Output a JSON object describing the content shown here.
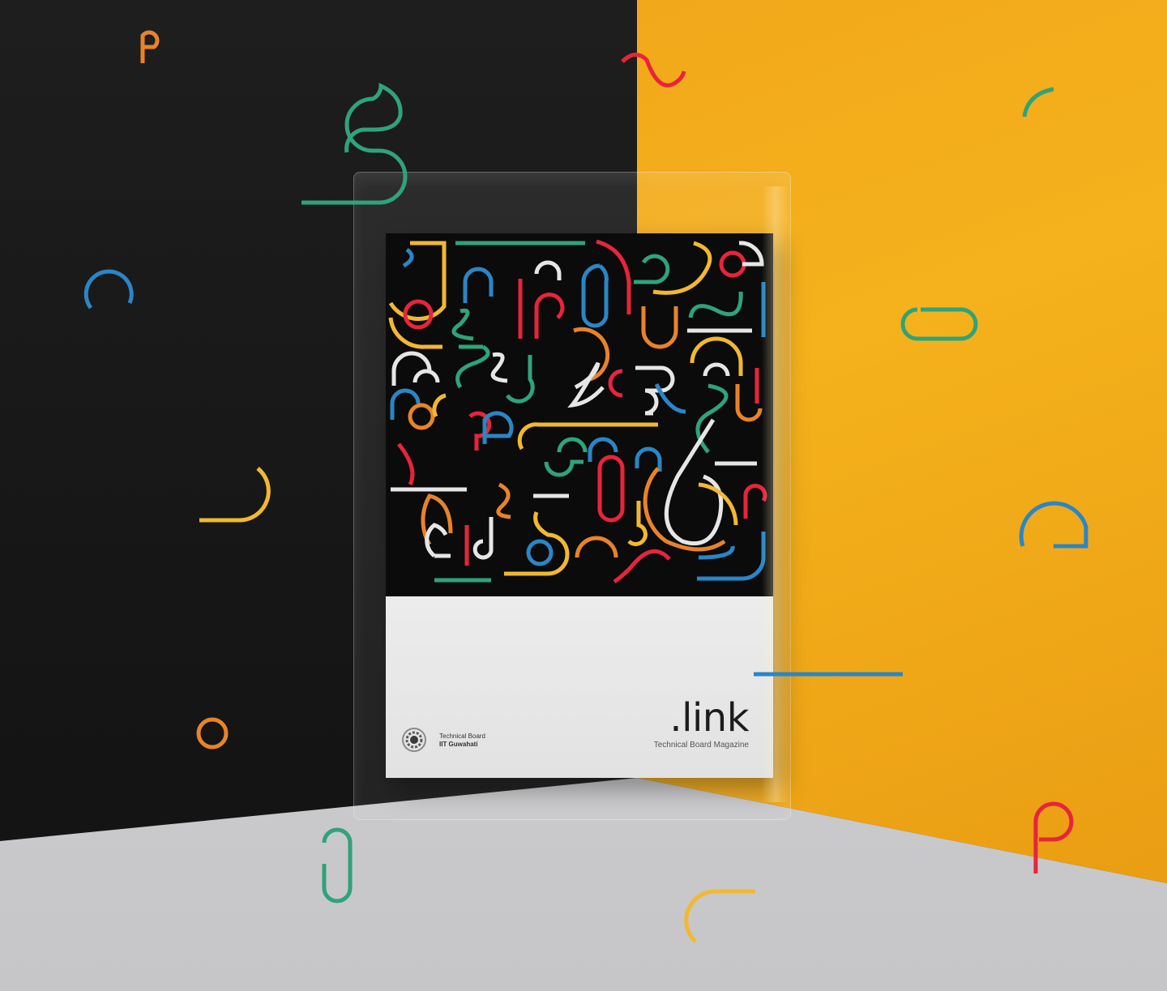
{
  "magazine": {
    "title": ".link",
    "subtitle": "Technical Board Magazine"
  },
  "publisher": {
    "line1": "Technical Board",
    "line2": "IIT Guwahati",
    "logo_icon": "gear-ring-icon"
  },
  "colors": {
    "left_wall": "#1e1e1e",
    "right_wall": "#f5b21c",
    "floor": "#d0d0d2",
    "cover_background": "#0b0b0b",
    "cover_bottom": "#e6e6e6",
    "accent_green": "#2fa37a",
    "accent_blue": "#2a86c6",
    "accent_red": "#e8243c",
    "accent_orange": "#e8832a",
    "accent_yellow": "#f2b830",
    "accent_white": "#e6e6e6"
  }
}
